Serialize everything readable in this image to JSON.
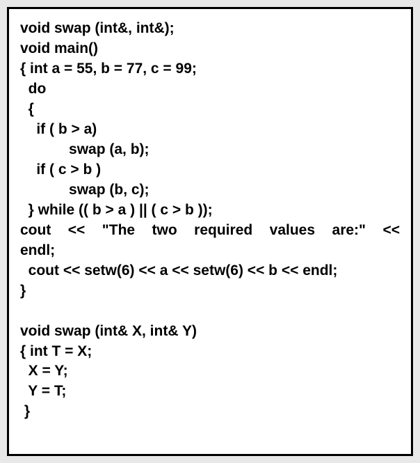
{
  "code": {
    "l1": "void swap (int&, int&);",
    "l2": "void main()",
    "l3": "{ int a = 55, b = 77, c = 99;",
    "l4": "  do",
    "l5": "  {",
    "l6": "    if ( b > a)",
    "l7": "            swap (a, b);",
    "l8": "    if ( c > b )",
    "l9": "            swap (b, c);",
    "l10": "  } while (( b > a ) || ( c > b ));",
    "l11": "  cout << \"The two required values are:\" <<",
    "l12": "endl;",
    "l13": "  cout << setw(6) << a << setw(6) << b << endl;",
    "l14": "}",
    "l15": "void swap (int& X, int& Y)",
    "l16": "{ int T = X;",
    "l17": "  X = Y;",
    "l18": "  Y = T;",
    "l19": " }"
  }
}
